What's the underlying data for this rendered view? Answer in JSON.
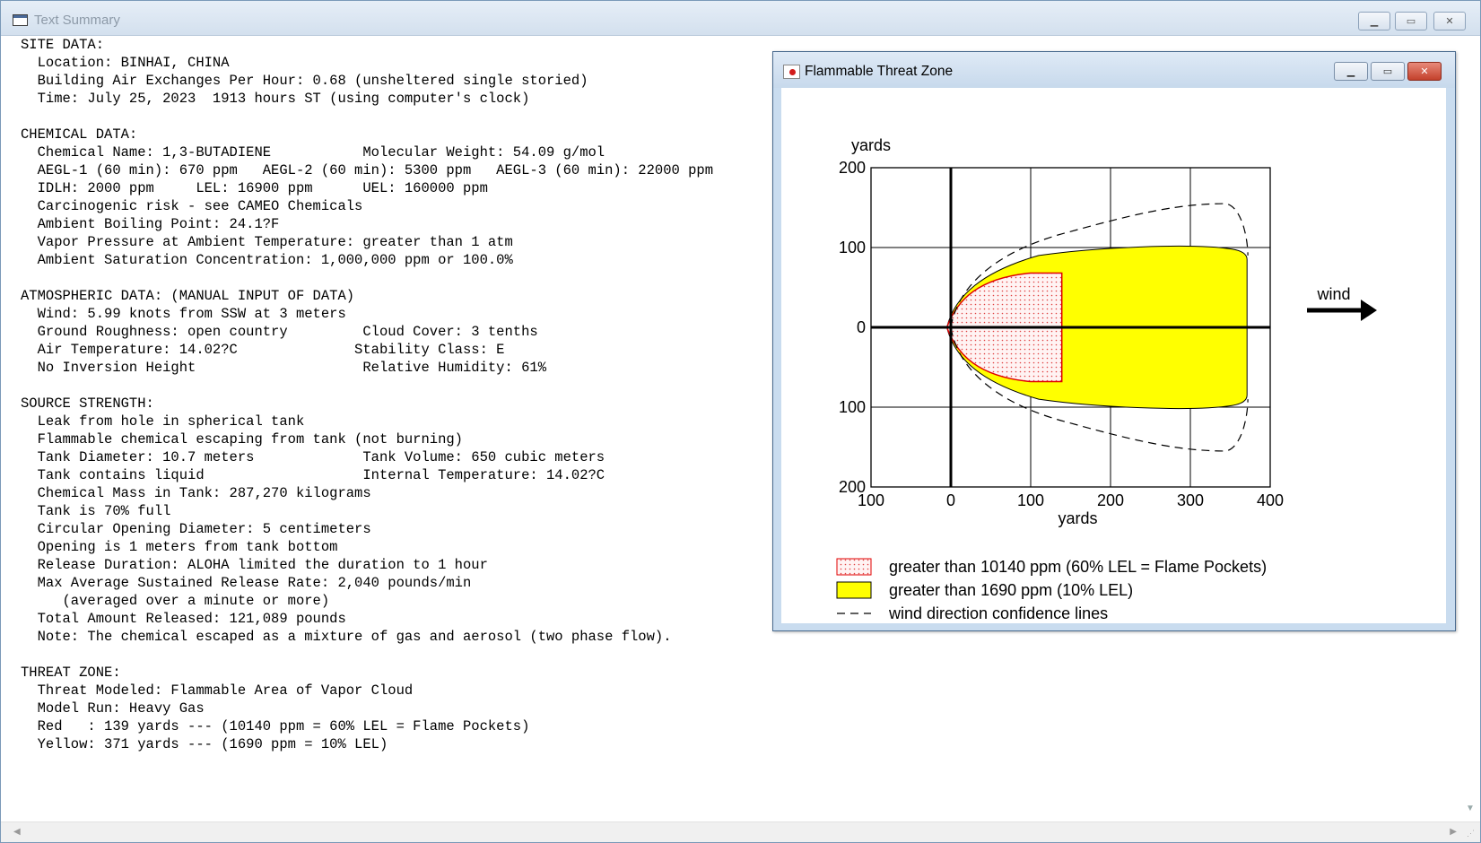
{
  "window": {
    "title": "Text Summary",
    "controls": {
      "minimize": "▁",
      "maximize": "▭",
      "close": "✕"
    }
  },
  "report_lines": [
    "SITE DATA:",
    "  Location: BINHAI, CHINA",
    "  Building Air Exchanges Per Hour: 0.68 (unsheltered single storied)",
    "  Time: July 25, 2023  1913 hours ST (using computer's clock)",
    "",
    "CHEMICAL DATA:",
    "  Chemical Name: 1,3-BUTADIENE           Molecular Weight: 54.09 g/mol",
    "  AEGL-1 (60 min): 670 ppm   AEGL-2 (60 min): 5300 ppm   AEGL-3 (60 min): 22000 ppm",
    "  IDLH: 2000 ppm     LEL: 16900 ppm      UEL: 160000 ppm",
    "  Carcinogenic risk - see CAMEO Chemicals",
    "  Ambient Boiling Point: 24.1?F",
    "  Vapor Pressure at Ambient Temperature: greater than 1 atm",
    "  Ambient Saturation Concentration: 1,000,000 ppm or 100.0%",
    "",
    "ATMOSPHERIC DATA: (MANUAL INPUT OF DATA)",
    "  Wind: 5.99 knots from SSW at 3 meters",
    "  Ground Roughness: open country         Cloud Cover: 3 tenths",
    "  Air Temperature: 14.02?C              Stability Class: E",
    "  No Inversion Height                    Relative Humidity: 61%",
    "",
    "SOURCE STRENGTH:",
    "  Leak from hole in spherical tank",
    "  Flammable chemical escaping from tank (not burning)",
    "  Tank Diameter: 10.7 meters             Tank Volume: 650 cubic meters",
    "  Tank contains liquid                   Internal Temperature: 14.02?C",
    "  Chemical Mass in Tank: 287,270 kilograms",
    "  Tank is 70% full",
    "  Circular Opening Diameter: 5 centimeters",
    "  Opening is 1 meters from tank bottom",
    "  Release Duration: ALOHA limited the duration to 1 hour",
    "  Max Average Sustained Release Rate: 2,040 pounds/min",
    "     (averaged over a minute or more)",
    "  Total Amount Released: 121,089 pounds",
    "  Note: The chemical escaped as a mixture of gas and aerosol (two phase flow).",
    "",
    "THREAT ZONE:",
    "  Threat Modeled: Flammable Area of Vapor Cloud",
    "  Model Run: Heavy Gas",
    "  Red   : 139 yards --- (10140 ppm = 60% LEL = Flame Pockets)",
    "  Yellow: 371 yards --- (1690 ppm = 10% LEL)"
  ],
  "threat_window": {
    "title": "Flammable Threat Zone",
    "controls": {
      "minimize": "▁",
      "maximize": "▭",
      "close": "✕"
    }
  },
  "chart_data": {
    "type": "area",
    "ylabel": "yards",
    "xlabel": "yards",
    "x_ticks": [
      "100",
      "0",
      "100",
      "200",
      "300",
      "400"
    ],
    "y_ticks": [
      "200",
      "100",
      "0",
      "100",
      "200"
    ],
    "xlim": [
      -100,
      400
    ],
    "ylim": [
      -200,
      200
    ],
    "wind_label": "wind",
    "zones": [
      {
        "name": "greater than 10140 ppm (60% LEL = Flame Pockets)",
        "color": "#f4a0a0",
        "extent_yards": 139
      },
      {
        "name": "greater than 1690 ppm (10% LEL)",
        "color": "#ffff00",
        "extent_yards": 371
      }
    ],
    "legend": [
      {
        "symbol": "red-dotted",
        "label": "greater than 10140 ppm (60% LEL = Flame Pockets)"
      },
      {
        "symbol": "yellow-fill",
        "label": "greater than 1690 ppm (10% LEL)"
      },
      {
        "symbol": "dashed-line",
        "label": "wind direction confidence lines"
      }
    ]
  }
}
